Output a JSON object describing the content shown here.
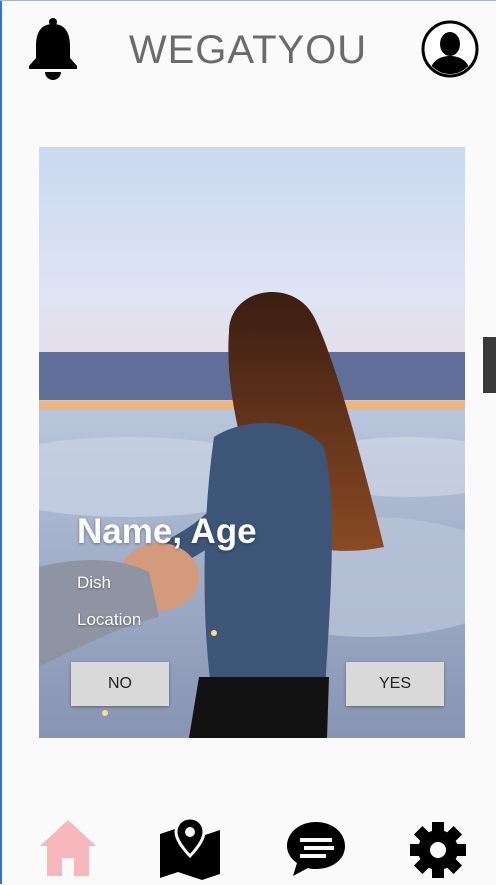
{
  "app": {
    "title": "WEGATYOU"
  },
  "header": {
    "left_icon": "bell-icon",
    "right_icon": "user-avatar-icon"
  },
  "card": {
    "name_age": "Name, Age",
    "dish": "Dish",
    "location": "Location",
    "photo": "person-leading-hand-above-clouds",
    "no_label": "NO",
    "yes_label": "YES"
  },
  "nav": {
    "items": [
      {
        "icon": "home-icon",
        "active": true
      },
      {
        "icon": "map-icon",
        "active": false
      },
      {
        "icon": "chat-icon",
        "active": false
      },
      {
        "icon": "gear-icon",
        "active": false
      }
    ]
  },
  "colors": {
    "background": "#fafafa",
    "title_text": "#6b6b6b",
    "button": "#d9d9d9",
    "nav_active": "#f7b8bd",
    "icon": "#000000"
  }
}
